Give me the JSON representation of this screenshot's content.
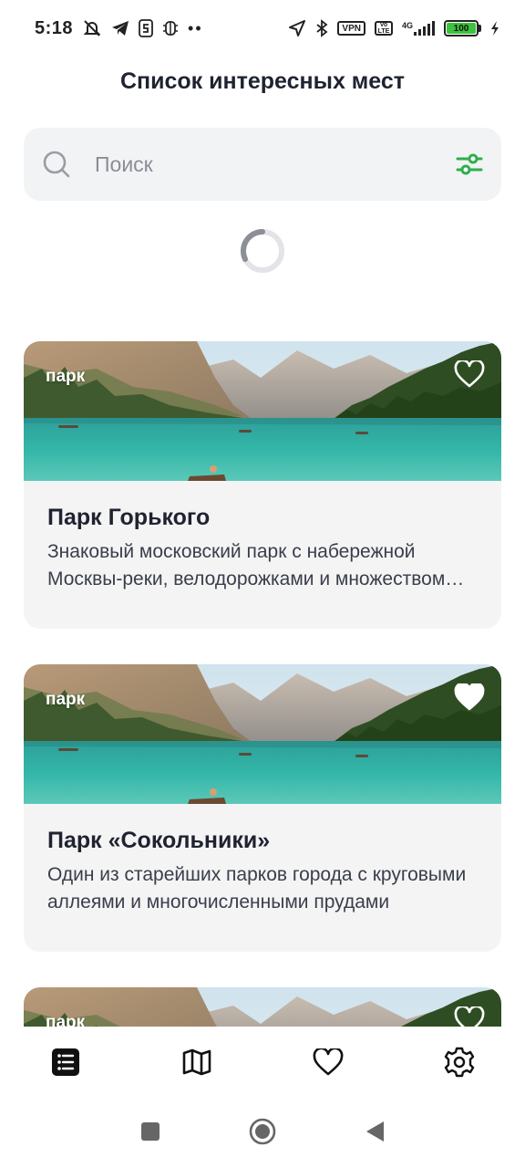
{
  "status_bar": {
    "time": "5:18",
    "vpn_label": "VPN",
    "volte_label": "Vo LTE",
    "network_label": "4G",
    "battery_level": "100"
  },
  "header": {
    "title": "Список интересных мест"
  },
  "search": {
    "placeholder": "Поиск",
    "value": ""
  },
  "places": [
    {
      "category": "парк",
      "title": "Парк Горького",
      "description": "Знаковый московский парк с набережной Москвы-реки, велодорожками и множеством кафе",
      "favorite": false
    },
    {
      "category": "парк",
      "title": "Парк «Сокольники»",
      "description": "Один из старейших парков города с круговыми аллеями и многочисленными прудами",
      "favorite": true
    },
    {
      "category": "парк",
      "favorite": false
    }
  ],
  "bottom_nav": {
    "active": "list",
    "items": [
      "list-icon",
      "map-icon",
      "heart-icon",
      "settings-icon"
    ]
  },
  "colors": {
    "accent_green": "#2fae4e",
    "text_dark": "#1f2330",
    "card_bg": "#f4f4f5",
    "search_bg": "#f2f3f5"
  }
}
